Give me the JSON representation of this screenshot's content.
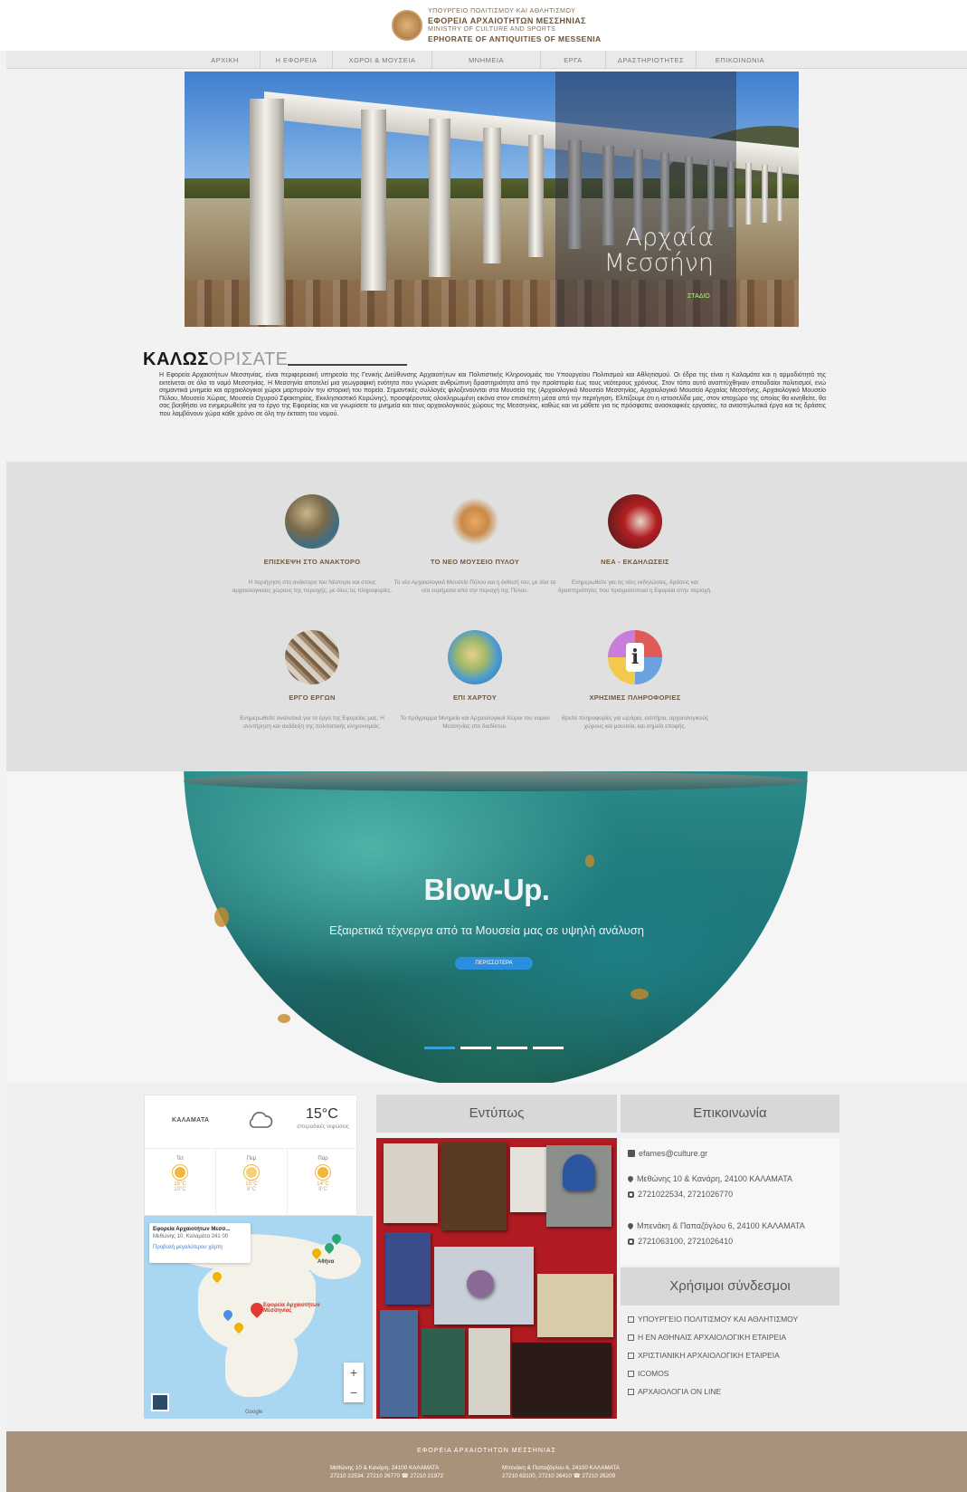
{
  "header": {
    "logo_line1": "ΥΠΟΥΡΓΕΙΟ ΠΟΛΙΤΙΣΜΟΥ ΚΑΙ ΑΘΛΗΤΙΣΜΟΥ",
    "logo_line2": "ΕΦΟΡΕΙΑ ΑΡΧΑΙΟΤΗΤΩΝ ΜΕΣΣΗΝΙΑΣ",
    "logo_line3": "MINISTRY OF CULTURE AND SPORTS",
    "logo_line4": "EPHORATE OF ANTIQUITIES OF MESSENIA"
  },
  "nav": [
    "ΑΡΧΙΚΗ",
    "Η ΕΦΟΡΕΙΑ",
    "ΧΩΡΟΙ & ΜΟΥΣΕΙΑ",
    "ΜΝΗΜΕΙΑ",
    "ΕΡΓΑ",
    "ΔΡΑΣΤΗΡΙΟΤΗΤΕΣ",
    "ΕΠΙΚΟΙΝΩΝΙΑ"
  ],
  "hero": {
    "title_line1": "Αρχαία",
    "title_line2": "Μεσσήνη",
    "link": "ΣΤΑΔΙΟ"
  },
  "welcome": {
    "title_bold": "ΚΑΛΩΣ",
    "title_light": "ΟΡΙΣΑΤΕ",
    "text": "Η Εφορεία Αρχαιοτήτων Μεσσηνίας, είναι περιφερειακή υπηρεσία της Γενικής Διεύθυνσης Αρχαιοτήτων και Πολιτιστικής Κληρονομιάς του Υπουργείου Πολιτισμού και Αθλητισμού. Οι έδρα της είναι η Καλαμάτα και η αρμοδιότητά της εκτείνεται σε όλο το νομό Μεσσηνίας. Η Μεσσηνία αποτελεί μια γεωγραφική ενότητα που γνώρισε ανθρώπινη δραστηριότητα από την προϊστορία έως τους νεότερους χρόνους. Στον τόπο αυτό αναπτύχθηκαν σπουδαίοι πολιτισμοί, ενώ σημαντικά μνημεία και αρχαιολογικοί χώροι μαρτυρούν την ιστορική του πορεία. Σημαντικές συλλογές φιλοξενούνται στα Μουσεία της (Αρχαιολογικό Μουσείο Μεσσηνίας, Αρχαιολογικό Μουσείο Αρχαίας Μεσσήνης, Αρχαιολογικό Μουσείο Πύλου, Μουσείο Χώρας, Μουσείο Οχυρού Σφακτηρίας, Εκκλησιαστικό Κορώνης), προσφέροντας ολοκληρωμένη εικόνα στον επισκέπτη μέσα από την περιήγηση. Ελπίζουμε ότι η ιστοσελίδα μας, στον ιστοχώρο της οποίας θα κινηθείτε, θα σας βοηθήσει να ενημερωθείτε για το έργο της Εφορείας και να γνωρίσετε τα μνημεία και τους αρχαιολογικούς χώρους της Μεσσηνίας, καθώς και να μάθετε για τις πρόσφατες ανασκαφικές εργασίες, τα αναστηλωτικά έργα και τις δράσεις που λαμβάνουν χώρα κάθε χρόνο σε όλη την έκταση του νομού."
  },
  "features": [
    {
      "title": "ΕΠΙΣΚΕΨΗ ΣΤΟ ΑΝΑΚΤΟΡΟ",
      "desc": "Η περιήγηση στο ανάκτορο του Νέστορα και στους αρχαιολογικούς χώρους της περιοχής, με όλες τις πληροφορίες."
    },
    {
      "title": "ΤΟ ΝΕΟ ΜΟΥΣΕΙΟ ΠΥΛΟΥ",
      "desc": "Το νέο Αρχαιολογικό Μουσείο Πύλου και η έκθεσή του, με όλα τα νέα ευρήματα από την περιοχή της Πύλου."
    },
    {
      "title": "ΝΕΑ - ΕΚΔΗΛΩΣΕΙΣ",
      "desc": "Ενημερωθείτε για τις νέες εκδηλώσεις, δράσεις και δραστηριότητες που πραγματοποιεί η Εφορεία στην περιοχή."
    },
    {
      "title": "ΕΡΓΟ ΕΡΓΩΝ",
      "desc": "Ενημερωθείτε αναλυτικά για τα έργα της Εφορείας μας. Η συντήρηση και ανάδειξη της πολιτιστικής κληρονομιάς."
    },
    {
      "title": "ΕΠΙ ΧΑΡΤΟΥ",
      "desc": "Το πρόγραμμα Μνημεία και Αρχαιολογικοί Χώροι του νομού Μεσσηνίας στο διαδίκτυο."
    },
    {
      "title": "ΧΡΗΣΙΜΕΣ ΠΛΗΡΟΦΟΡΙΕΣ",
      "desc": "Βρείτε πληροφορίες για ωράρια, εισιτήρια, αρχαιολογικούς χώρους και μουσεία, και σημεία επαφής."
    }
  ],
  "blowup": {
    "title": "Blow-Up.",
    "subtitle": "Εξαιρετικά τέχνεργα από τα Μουσεία μας σε υψηλή ανάλυση",
    "button": "ΠΕΡΙΣΣΟΤΕΡΑ"
  },
  "weather": {
    "city": "ΚΑΛΑΜΑΤΑ",
    "temp": "15°C",
    "desc": "σποραδικές νεφώσεις",
    "days": [
      {
        "name": "Τετ",
        "hi": "15°C",
        "lo": "10°C"
      },
      {
        "name": "Πεμ",
        "hi": "15°C",
        "lo": "8°C"
      },
      {
        "name": "Παρ",
        "hi": "14°C",
        "lo": "9°C"
      }
    ]
  },
  "map": {
    "card_title": "Εφορεία Αρχαιοτήτων Μεσσ...",
    "card_addr": "Μεθώνης 10, Καλαμάτα 241 00",
    "card_link": "Προβολή μεγαλύτερου χάρτη",
    "marker_label": "Εφορεία Αρχαιοτήτων Μεσσηνίας",
    "city_label": "Αθήνα",
    "zoom_in": "+",
    "zoom_out": "−",
    "brand": "Google"
  },
  "entypos": {
    "title": "Εντύπως"
  },
  "contact": {
    "title": "Επικοινωνία",
    "email": "efames@culture.gr",
    "addr1": "Μεθώνης 10 & Κανάρη, 24100 ΚΑΛΑΜΑΤΑ",
    "phone1": "2721022534, 2721026770",
    "addr2": "Μπενάκη & Παπαζόγλου 6, 24100 ΚΑΛΑΜΑΤΑ",
    "phone2": "2721063100, 2721026410"
  },
  "links": {
    "title": "Χρήσιμοι σύνδεσμοι",
    "items": [
      "ΥΠΟΥΡΓΕΙΟ ΠΟΛΙΤΙΣΜΟΥ ΚΑΙ ΑΘΛΗΤΙΣΜΟΥ",
      "Η ΕΝ ΑΘΗΝΑΙΣ ΑΡΧΑΙΟΛΟΓΙΚΗ ΕΤΑΙΡΕΙΑ",
      "ΧΡΙΣΤΙΑΝΙΚΗ ΑΡΧΑΙΟΛΟΓΙΚΗ ΕΤΑΙΡΕΙΑ",
      "ICOMOS",
      "ΑΡΧΑΙΟΛΟΓΙΑ ON LINE"
    ]
  },
  "footer": {
    "title": "ΕΦΟΡΕΙΑ ΑΡΧΑΙΟΤΗΤΩΝ ΜΕΣΣΗΝΙΑΣ",
    "col1_line1": "Μεθώνης 10 & Κανάρη, 24100 ΚΑΛΑΜΑΤΑ",
    "col1_line2": "27210 22534, 27210 26770 ☎ 27210 21972",
    "col2_line1": "Μπενάκη & Παπαζόγλου 6, 24100 ΚΑΛΑΜΑΤΑ",
    "col2_line2": "27210 63100, 27210 26410 ☎ 27210 26209"
  },
  "colors": {
    "footer": "#a9927b",
    "accent": "#6b5a44",
    "button": "#2b8fe0"
  }
}
